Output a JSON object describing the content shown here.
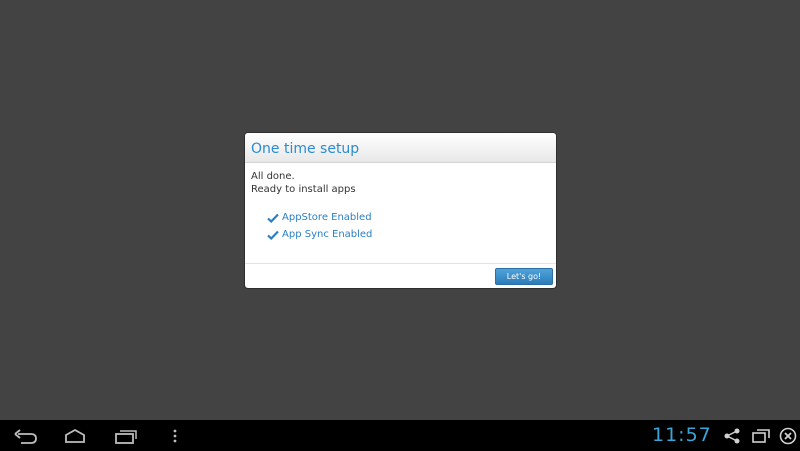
{
  "dialog": {
    "title": "One time setup",
    "message_line1": "All done.",
    "message_line2": "Ready to install apps",
    "checks": [
      {
        "label": "AppStore Enabled",
        "icon": "checkmark-icon"
      },
      {
        "label": "App Sync Enabled",
        "icon": "checkmark-icon"
      }
    ],
    "button_label": "Let's go!"
  },
  "navbar": {
    "clock": "11:57",
    "left_icons": [
      "back-icon",
      "home-icon",
      "recent-apps-icon",
      "menu-dots-icon"
    ],
    "right_icons": [
      "share-icon",
      "window-resize-icon",
      "close-circle-icon"
    ]
  },
  "colors": {
    "background": "#434343",
    "accent": "#2a8bd1",
    "clock": "#3aa5d8"
  }
}
